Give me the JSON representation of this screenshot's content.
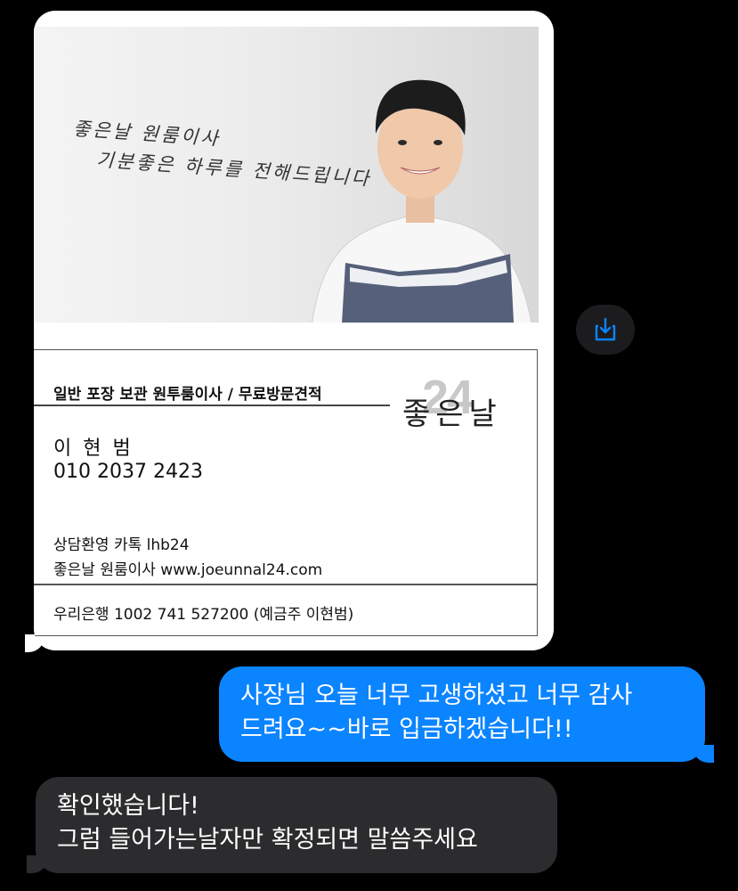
{
  "card": {
    "slogan_line1": "좋은날 원룸이사",
    "slogan_line2": "기분좋은 하루를 전해드립니다",
    "services": "일반  포장  보관  원투룸이사 / 무료방문견적",
    "name": "이 현 범",
    "phone": "010 2037 2423",
    "kakao": "상담환영 카톡 lhb24",
    "website": "좋은날 원룸이사 www.joeunnal24.com",
    "bank": "우리은행 1002 741 527200 (예금주 이현범)",
    "logo_number": "24",
    "logo_text": "좋은날"
  },
  "save_button": {
    "icon": "save-download-icon",
    "color": "#0b84ff"
  },
  "messages": [
    {
      "from": "me",
      "lines": [
        "사장님 오늘 너무 고생하셨고 너무 감사",
        "드려요~~바로 입금하겠습니다!!"
      ],
      "color": "#0b84ff"
    },
    {
      "from": "them",
      "lines": [
        "확인했습니다!",
        "그럼 들어가는날자만 확정되면 말씀주세요"
      ],
      "color": "#2c2c2e"
    }
  ]
}
